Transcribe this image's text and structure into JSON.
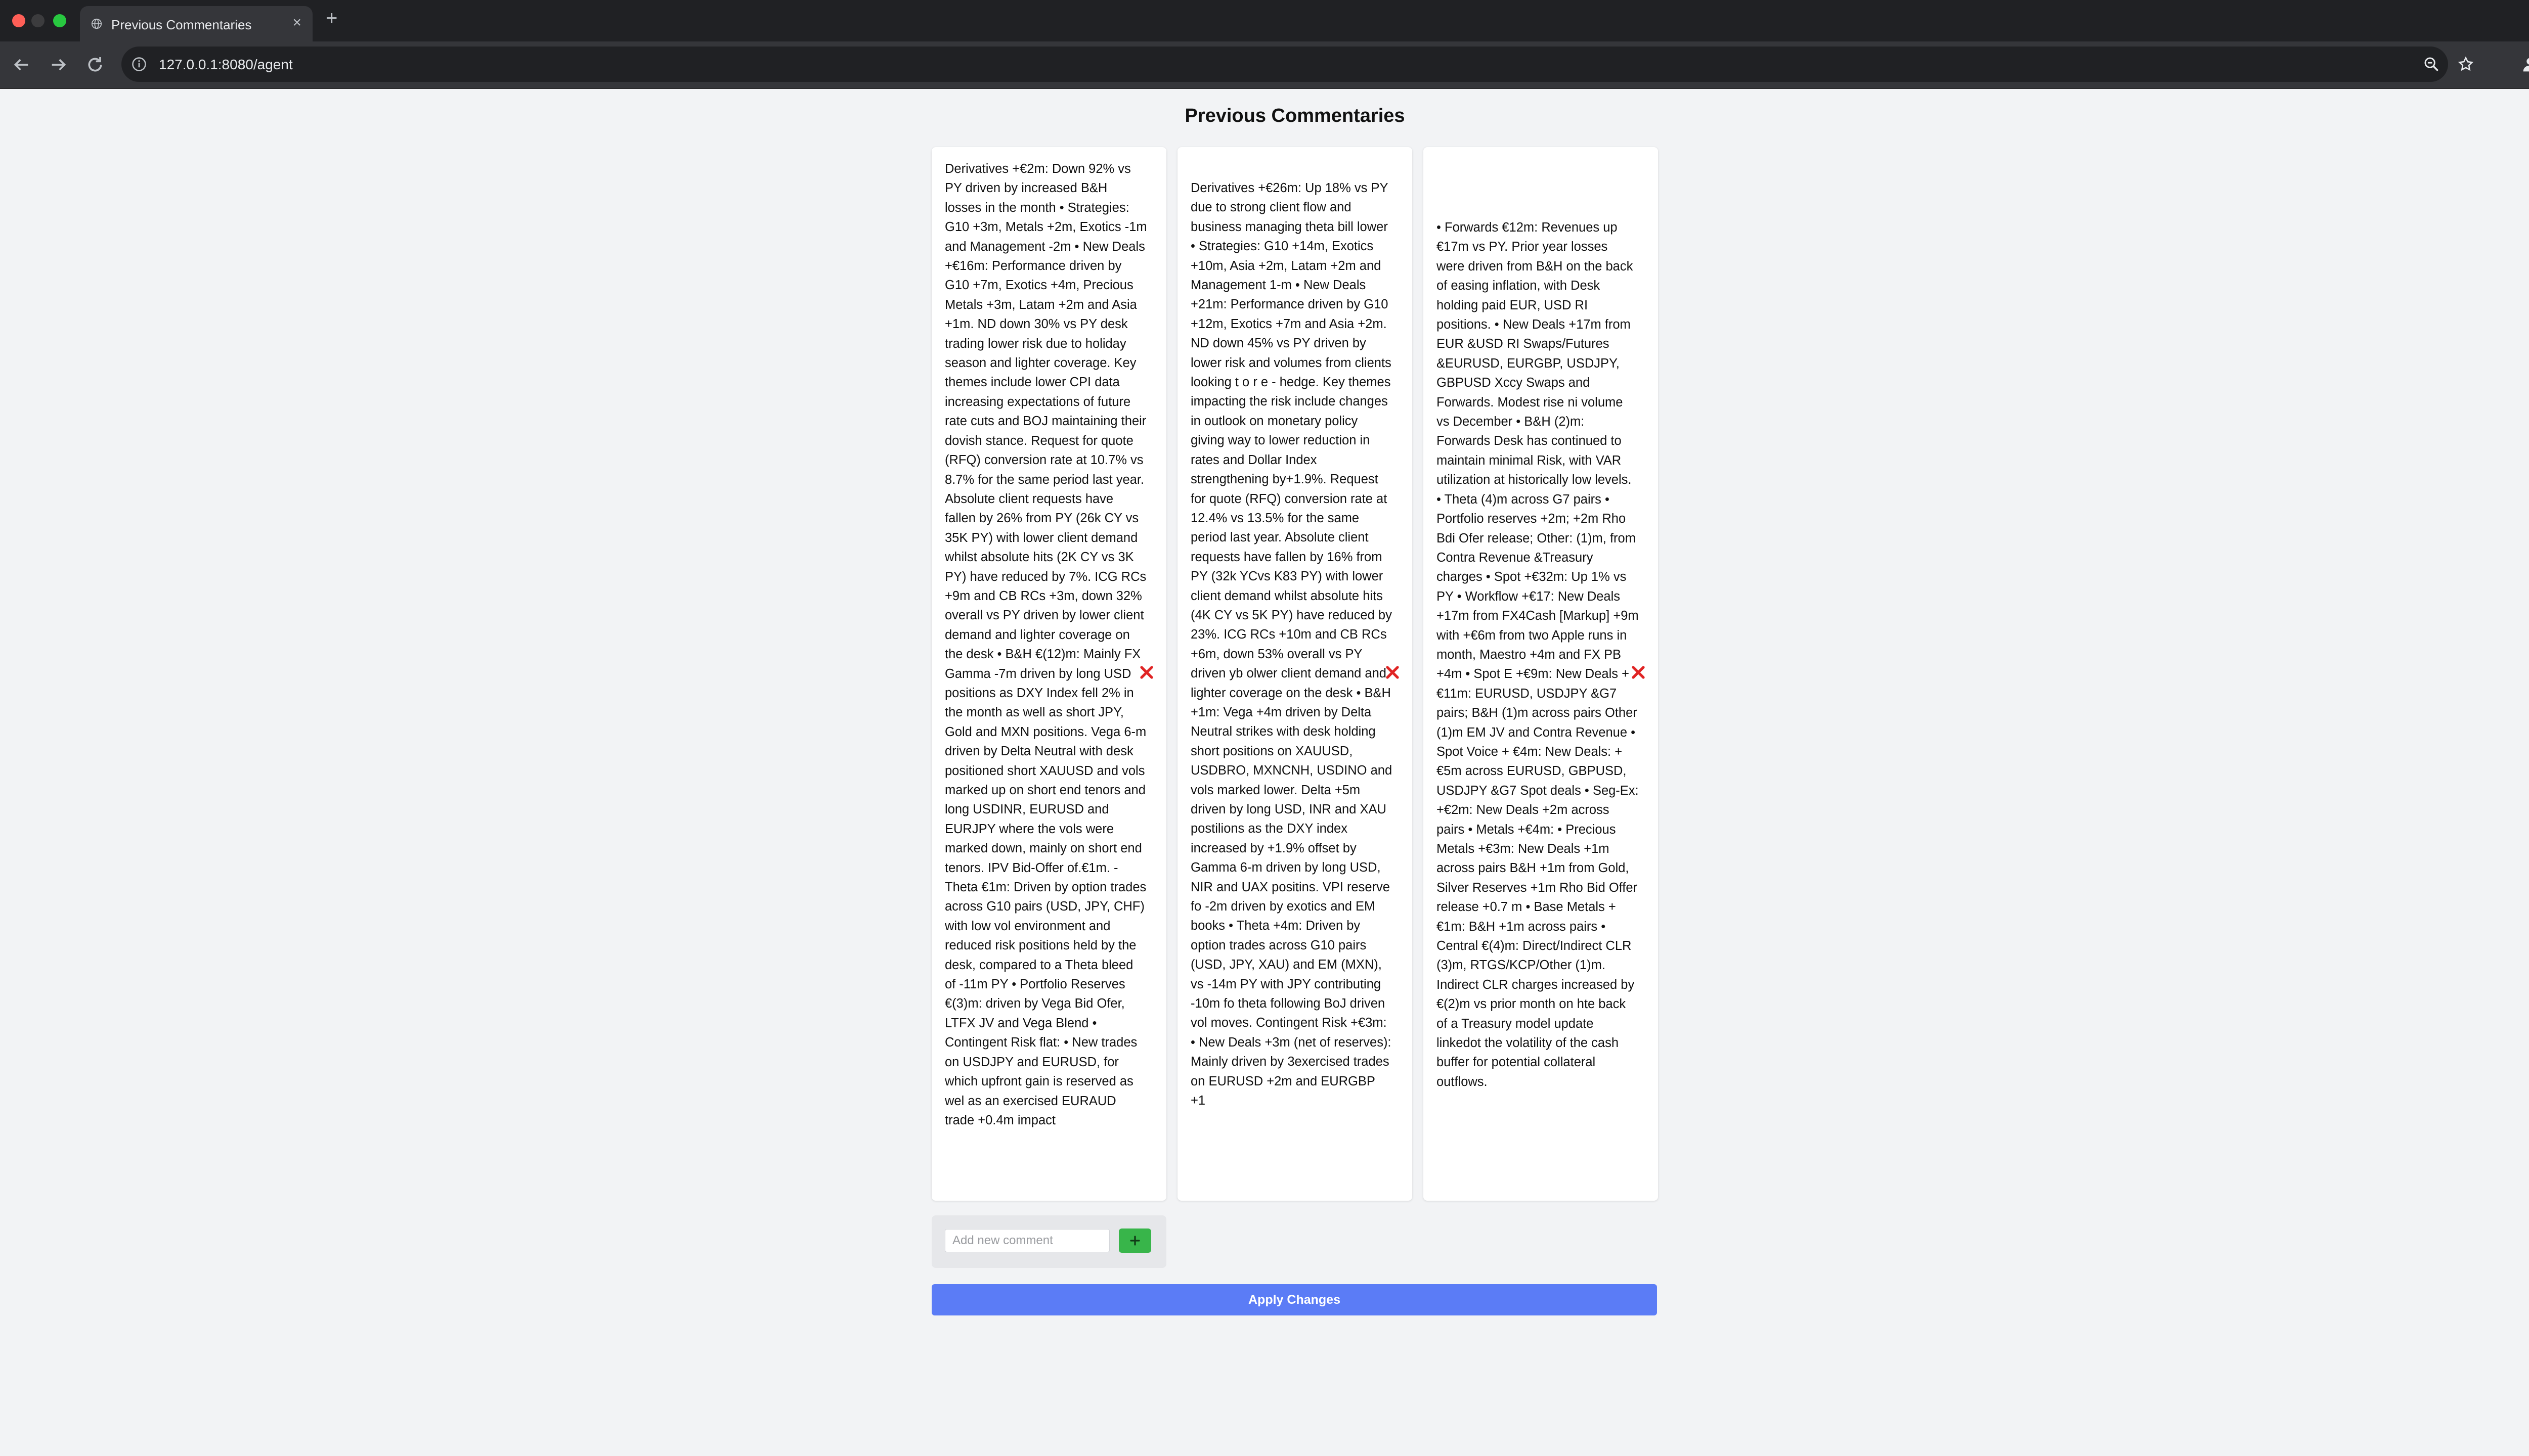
{
  "browser": {
    "tab_title": "Previous Commentaries",
    "url": "127.0.0.1:8080/agent"
  },
  "page": {
    "title": "Previous Commentaries"
  },
  "commentaries": [
    {
      "text": "Derivatives +€2m: Down 92% vs PY driven by increased B&H losses in the month • Strategies: G10 +3m, Metals +2m, Exotics -1m and Management -2m • New Deals +€16m: Performance driven by G10 +7m, Exotics +4m, Precious Metals +3m, Latam +2m and Asia +1m. ND down 30% vs PY desk trading lower risk due to holiday season and lighter coverage. Key themes include lower CPI data increasing expectations of future rate cuts and BOJ maintaining their dovish stance. Request for quote (RFQ) conversion rate at 10.7% vs 8.7% for the same period last year. Absolute client requests have fallen by 26% from PY (26k CY vs 35K PY) with lower client demand whilst absolute hits (2K CY vs 3K PY) have reduced by 7%. ICG RCs +9m and CB RCs +3m, down 32% overall vs PY driven by lower client demand and lighter coverage on the desk • B&H €(12)m: Mainly FX Gamma -7m driven by long USD positions as DXY Index fell 2% in the month as well as short JPY, Gold and MXN positions. Vega 6-m driven by Delta Neutral with desk positioned short XAUUSD and vols marked up on short end tenors and long USDINR, EURUSD and EURJPY where the vols were marked down, mainly on short end tenors. IPV Bid-Offer of.€1m. - Theta €1m: Driven by option trades across G10 pairs (USD, JPY, CHF) with low vol environment and reduced risk positions held by the desk, compared to a Theta bleed of -11m PY • Portfolio Reserves €(3)m: driven by Vega Bid Ofer, LTFX JV and Vega Blend • Contingent Risk flat: • New trades on USDJPY and EURUSD, for which upfront gain is reserved as wel as an exercised EURAUD trade +0.4m impact",
      "delete_icon": "close-icon"
    },
    {
      "text": "Derivatives +€26m: Up 18% vs PY due to strong client flow and business managing theta bill lower • Strategies: G10 +14m, Exotics +10m, Asia +2m, Latam +2m and Management 1-m • New Deals +21m: Performance driven by G10 +12m, Exotics +7m and Asia +2m. ND down 45% vs PY driven by lower risk and volumes from clients looking t o r e - hedge. Key themes impacting the risk include changes in outlook on monetary policy giving way to lower reduction in rates and Dollar Index strengthening by+1.9%. Request for quote (RFQ) conversion rate at 12.4% vs 13.5% for the same period last year. Absolute client requests have fallen by 16% from PY (32k YCvs K83 PY) with lower client demand whilst absolute hits (4K CY vs 5K PY) have reduced by 23%. ICG RCs +10m and CB RCs +6m, down 53% overall vs PY driven yb olwer client demand and lighter coverage on the desk • B&H +1m: Vega +4m driven by Delta Neutral strikes with desk holding short positions on XAUUSD, USDBRO, MXNCNH, USDINO and vols marked lower. Delta +5m driven by long USD, INR and XAU postilions as the DXY index increased by +1.9% offset by Gamma 6-m driven by long USD, NIR and UAX positins. VPI reserve fo -2m driven by exotics and EM books • Theta +4m: Driven by option trades across G10 pairs (USD, JPY, XAU) and EM (MXN), vs -14m PY with JPY contributing -10m fo theta following BoJ driven vol moves. Contingent Risk +€3m: • New Deals +3m (net of reserves): Mainly driven by 3exercised trades on EURUSD +2m and EURGBP +1",
      "delete_icon": "close-icon"
    },
    {
      "text": "• Forwards €12m: Revenues up €17m vs PY. Prior year losses were driven from B&H on the back of easing inflation, with Desk holding paid EUR, USD RI positions. • New Deals +17m from EUR &USD RI Swaps/Futures &EURUSD, EURGBP, USDJPY, GBPUSD Xccy Swaps and Forwards. Modest rise ni volume vs December • B&H (2)m: Forwards Desk has continued to maintain minimal Risk, with VAR utilization at historically low levels. • Theta (4)m across G7 pairs • Portfolio reserves +2m; +2m Rho Bdi Ofer release; Other: (1)m, from Contra Revenue &Treasury charges • Spot +€32m: Up 1% vs PY • Workflow +€17: New Deals +17m from FX4Cash [Markup] +9m with +€6m from two Apple runs in month, Maestro +4m and FX PB +4m • Spot E +€9m: New Deals +€11m: EURUSD, USDJPY &G7 pairs; B&H (1)m across pairs Other (1)m EM JV and Contra Revenue • Spot Voice + €4m: New Deals: +€5m across EURUSD, GBPUSD, USDJPY &G7 Spot deals • Seg-Ex: +€2m: New Deals +2m across pairs • Metals +€4m: • Precious Metals +€3m: New Deals +1m across pairs B&H +1m from Gold, Silver Reserves +1m Rho Bid Offer release +0.7 m • Base Metals + €1m: B&H +1m across pairs • Central €(4)m: Direct/Indirect CLR (3)m, RTGS/KCP/Other (1)m. Indirect CLR charges increased by €(2)m vs prior month on hte back of a Treasury model update linkedot the volatility of the cash buffer for potential collateral outflows.",
      "delete_icon": "close-icon"
    }
  ],
  "add_comment": {
    "placeholder": "Add new comment",
    "button_icon": "plus-icon"
  },
  "apply_button": {
    "label": "Apply Changes"
  },
  "colors": {
    "apply": "#5b7cf6",
    "add": "#38b54a",
    "delete": "#e02424"
  }
}
